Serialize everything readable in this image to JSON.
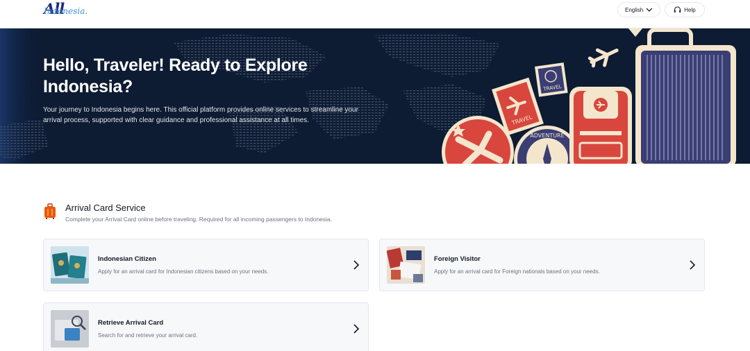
{
  "header": {
    "logo_all": "All",
    "logo_indonesia": "Indonesia.",
    "language_label": "English",
    "help_label": "Help"
  },
  "hero": {
    "title": "Hello, Traveler! Ready to Explore Indonesia?",
    "description": "Your journey to Indonesia begins here. This official platform provides online services to streamline your arrival process, supported with clear guidance and professional assistance at all times.",
    "stamp_travel_1": "TRAVEL",
    "stamp_travel_2": "TRAVEL",
    "stamp_adventure": "ADVENTURE"
  },
  "section": {
    "title": "Arrival Card Service",
    "subtitle": "Complete your Arrival Card online before traveling. Required for all incoming passengers to Indonesia."
  },
  "cards": [
    {
      "title": "Indonesian Citizen",
      "description": "Apply for an arrival card for Indonesian citizens based on your needs."
    },
    {
      "title": "Foreign Visitor",
      "description": "Apply for an arrival card for Foreign nationals based on your needs."
    },
    {
      "title": "Retrieve Arrival Card",
      "description": "Search for and retrieve your arrival card."
    }
  ],
  "colors": {
    "hero_bg": "#0d1b33",
    "accent_red": "#d9463e",
    "cream": "#f3e6cc",
    "luggage_purple": "#3a3e73"
  }
}
